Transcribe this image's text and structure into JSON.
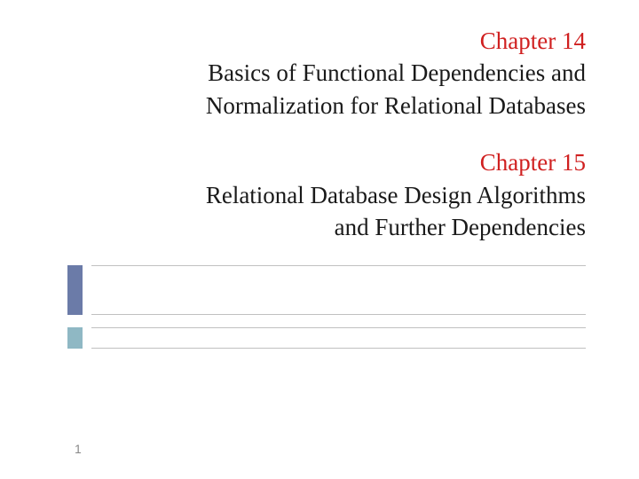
{
  "header": {
    "ch14_label": "Chapter 14",
    "ch14_title_line1": "Basics of Functional Dependencies and",
    "ch14_title_line2": "Normalization for Relational Databases",
    "ch15_label": "Chapter 15",
    "ch15_title_line1": "Relational Database Design Algorithms",
    "ch15_title_line2": "and Further Dependencies"
  },
  "page_number": "1",
  "colors": {
    "chapter_label": "#d02020",
    "accent1": "#6b7ba8",
    "accent2": "#8fb8c4"
  }
}
